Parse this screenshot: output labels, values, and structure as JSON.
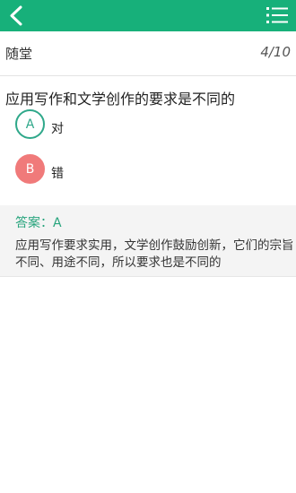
{
  "colors": {
    "accent": "#17b07a",
    "correct": "#2fa88a",
    "wrong": "#f07a7a",
    "answer": "#27a47c"
  },
  "topbar": {
    "back_icon": "chevron-left-icon",
    "menu_icon": "list-menu-icon"
  },
  "header": {
    "mode_label": "随堂",
    "progress": "4/10"
  },
  "question": {
    "text": "应用写作和文学创作的要求是不同的"
  },
  "options": [
    {
      "letter": "A",
      "text": "对",
      "state": "correct"
    },
    {
      "letter": "B",
      "text": "错",
      "state": "wrong"
    }
  ],
  "answer": {
    "label": "答案：A",
    "explanation": "应用写作要求实用，文学创作鼓励创新，它们的宗旨不同、用途不同，所以要求也是不同的"
  }
}
